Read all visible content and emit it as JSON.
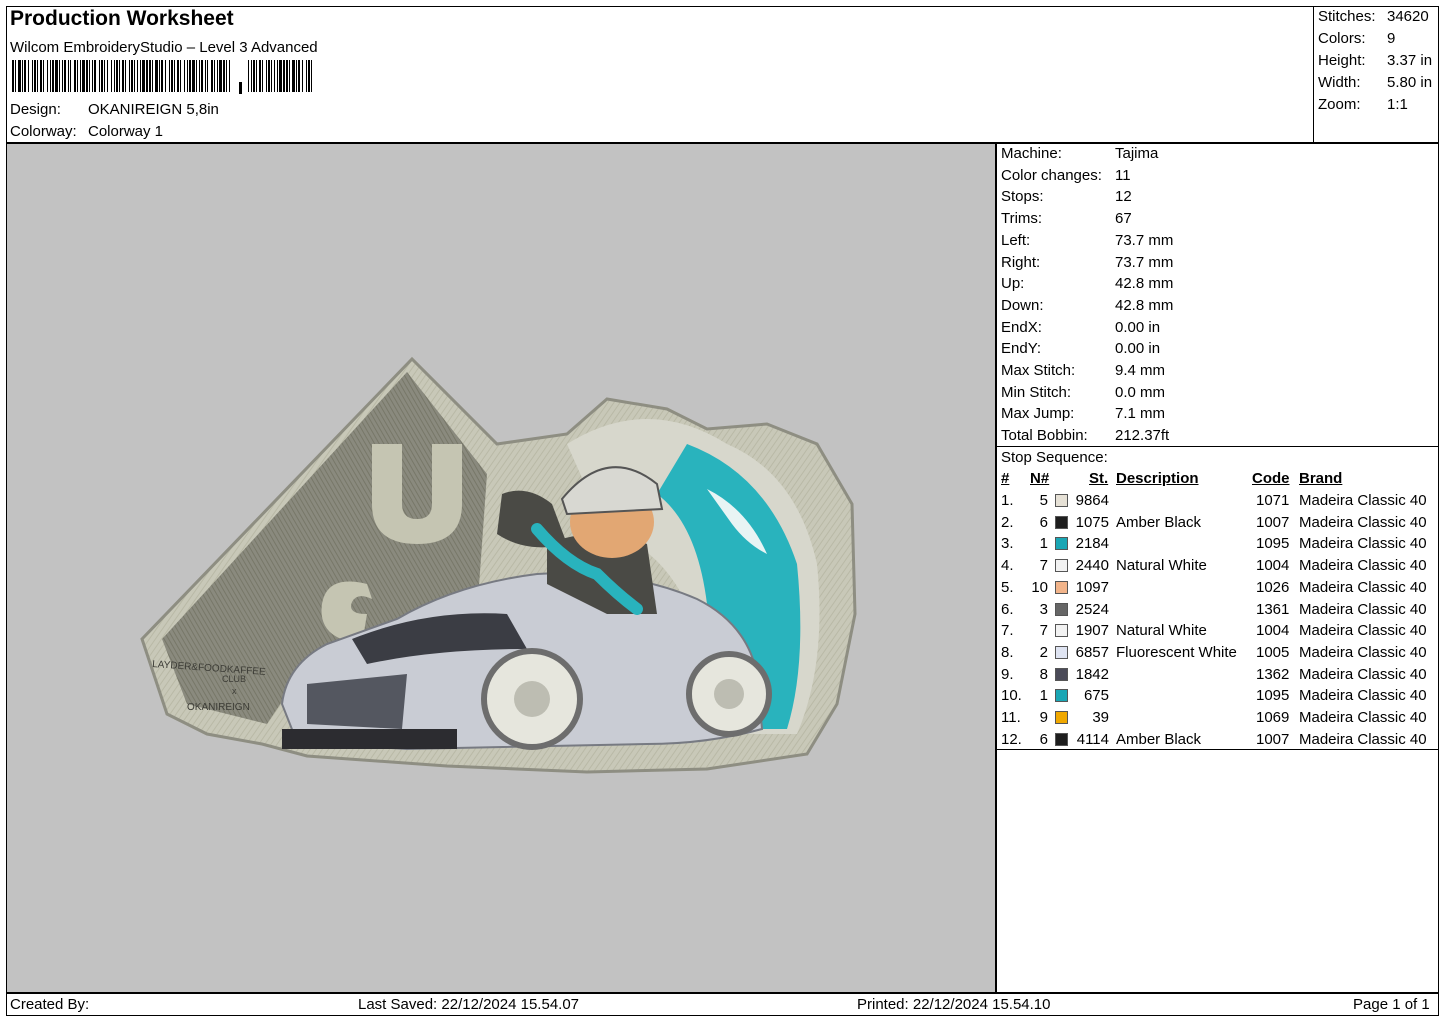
{
  "header": {
    "title": "Production Worksheet",
    "subtitle": "Wilcom EmbroideryStudio – Level 3 Advanced",
    "design_label": "Design:",
    "design_value": "OKANIREIGN 5,8in",
    "colorway_label": "Colorway:",
    "colorway_value": "Colorway 1"
  },
  "stats": [
    {
      "label": "Stitches:",
      "value": "34620"
    },
    {
      "label": "Colors:",
      "value": "9"
    },
    {
      "label": "Height:",
      "value": "3.37 in"
    },
    {
      "label": "Width:",
      "value": "5.80 in"
    },
    {
      "label": "Zoom:",
      "value": "1:1"
    }
  ],
  "machine_info": [
    {
      "label": "Machine:",
      "value": "Tajima"
    },
    {
      "label": "Color changes:",
      "value": "11"
    },
    {
      "label": "Stops:",
      "value": "12"
    },
    {
      "label": "Trims:",
      "value": "67"
    },
    {
      "label": "Left:",
      "value": "73.7 mm"
    },
    {
      "label": "Right:",
      "value": "73.7 mm"
    },
    {
      "label": "Up:",
      "value": "42.8 mm"
    },
    {
      "label": "Down:",
      "value": "42.8 mm"
    },
    {
      "label": "EndX:",
      "value": "0.00 in"
    },
    {
      "label": "EndY:",
      "value": "0.00 in"
    },
    {
      "label": "Max Stitch:",
      "value": "9.4 mm"
    },
    {
      "label": "Min Stitch:",
      "value": "0.0 mm"
    },
    {
      "label": "Max Jump:",
      "value": "7.1 mm"
    },
    {
      "label": "Total Bobbin:",
      "value": "212.37ft"
    }
  ],
  "stop_sequence": {
    "title": "Stop Sequence:",
    "columns": [
      "#",
      "N#",
      "St.",
      "Description",
      "Code",
      "Brand"
    ],
    "rows": [
      {
        "idx": "1.",
        "n": "5",
        "color": "#e6e1d6",
        "st": "9864",
        "desc": "",
        "code": "1071",
        "brand": "Madeira Classic 40"
      },
      {
        "idx": "2.",
        "n": "6",
        "color": "#1e1e1e",
        "st": "1075",
        "desc": "Amber Black",
        "code": "1007",
        "brand": "Madeira Classic 40"
      },
      {
        "idx": "3.",
        "n": "1",
        "color": "#1aa6b4",
        "st": "2184",
        "desc": "",
        "code": "1095",
        "brand": "Madeira Classic 40"
      },
      {
        "idx": "4.",
        "n": "7",
        "color": "#f2f2f2",
        "st": "2440",
        "desc": "Natural White",
        "code": "1004",
        "brand": "Madeira Classic 40"
      },
      {
        "idx": "5.",
        "n": "10",
        "color": "#f2b48a",
        "st": "1097",
        "desc": "",
        "code": "1026",
        "brand": "Madeira Classic 40"
      },
      {
        "idx": "6.",
        "n": "3",
        "color": "#666666",
        "st": "2524",
        "desc": "",
        "code": "1361",
        "brand": "Madeira Classic 40"
      },
      {
        "idx": "7.",
        "n": "7",
        "color": "#f2f2f2",
        "st": "1907",
        "desc": "Natural White",
        "code": "1004",
        "brand": "Madeira Classic 40"
      },
      {
        "idx": "8.",
        "n": "2",
        "color": "#dfe4f2",
        "st": "6857",
        "desc": "Fluorescent White",
        "code": "1005",
        "brand": "Madeira Classic 40"
      },
      {
        "idx": "9.",
        "n": "8",
        "color": "#4a4a58",
        "st": "1842",
        "desc": "",
        "code": "1362",
        "brand": "Madeira Classic 40"
      },
      {
        "idx": "10.",
        "n": "1",
        "color": "#1aa6b4",
        "st": "675",
        "desc": "",
        "code": "1095",
        "brand": "Madeira Classic 40"
      },
      {
        "idx": "11.",
        "n": "9",
        "color": "#f0a800",
        "st": "39",
        "desc": "",
        "code": "1069",
        "brand": "Madeira Classic 40"
      },
      {
        "idx": "12.",
        "n": "6",
        "color": "#1e1e1e",
        "st": "4114",
        "desc": "Amber Black",
        "code": "1007",
        "brand": "Madeira Classic 40"
      }
    ]
  },
  "footer": {
    "created_by": "Created By:",
    "last_saved": "Last Saved: 22/12/2024 15.54.07",
    "printed": "Printed: 22/12/2024 15.54.10",
    "page": "Page 1 of 1"
  },
  "preview": {
    "patch_text_line1": "LAYDER&FOODKAFFEE",
    "patch_text_line2": "CLUB",
    "patch_text_line3": "x",
    "patch_text_line4": "OKANIREIGN"
  }
}
